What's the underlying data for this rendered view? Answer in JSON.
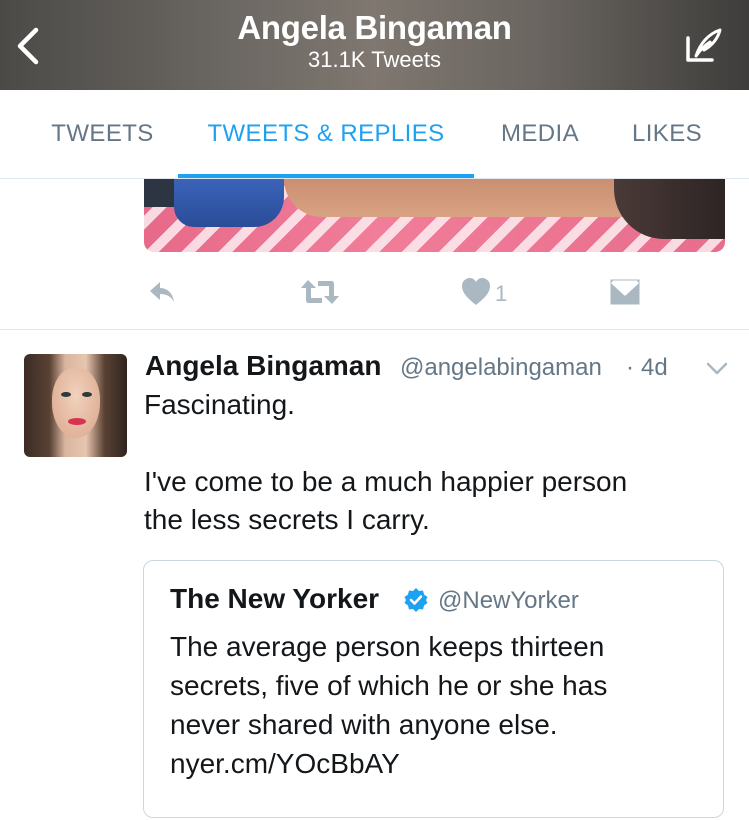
{
  "header": {
    "title": "Angela Bingaman",
    "subtitle": "31.1K Tweets"
  },
  "tabs": [
    {
      "label": "TWEETS",
      "active": false
    },
    {
      "label": "TWEETS & REPLIES",
      "active": true
    },
    {
      "label": "MEDIA",
      "active": false
    },
    {
      "label": "LIKES",
      "active": false
    }
  ],
  "previous_tweet": {
    "like_count": "1",
    "actions": [
      "reply-icon",
      "retweet-icon",
      "heart-icon",
      "direct-message-icon"
    ]
  },
  "tweet": {
    "author_name": "Angela Bingaman",
    "handle": "@angelabingaman",
    "separator": "·",
    "time": "4d",
    "text_lines": [
      "Fascinating.",
      "I've come to be a much happier person",
      "the less secrets I carry."
    ],
    "quoted": {
      "author_name": "The New Yorker",
      "verified": true,
      "handle": "@NewYorker",
      "text_lines": [
        "The average person keeps thirteen",
        "secrets, five of which he or she has",
        "never shared with anyone else.",
        "nyer.cm/YOcBbAY"
      ]
    }
  },
  "colors": {
    "accent": "#1da1f2",
    "text_primary": "#14171a",
    "text_secondary": "#657786",
    "icon_gray": "#aab8c2",
    "divider": "#e1e8ed"
  }
}
